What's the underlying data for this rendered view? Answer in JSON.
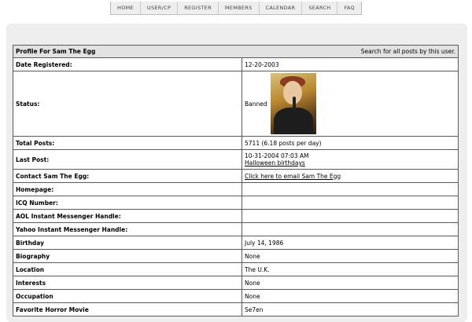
{
  "nav": [
    "HOME",
    "USER/CP",
    "REGISTER",
    "MEMBERS",
    "CALENDAR",
    "SEARCH",
    "FAQ"
  ],
  "profile": {
    "header_title": "Profile For Sam The Egg",
    "search_link": "Search for all posts by this user.",
    "date_registered_label": "Date Registered:",
    "date_registered": "12-20-2003",
    "status_label": "Status:",
    "status": "Banned",
    "total_posts_label": "Total Posts:",
    "total_posts": "5711 (6.18 posts per day)",
    "last_post_label": "Last Post:",
    "last_post_date": "10-31-2004 07:03 AM",
    "last_post_thread": "Halloween birthdays",
    "contact_label": "Contact Sam The Egg:",
    "contact_link": "Click here to email Sam The Egg",
    "homepage_label": "Homepage:",
    "homepage": "",
    "icq_label": "ICQ Number:",
    "icq": "",
    "aol_label": "AOL Instant Messenger Handle:",
    "aol": "",
    "yahoo_label": "Yahoo Instant Messenger Handle:",
    "yahoo": "",
    "birthday_label": "Birthday",
    "birthday": "July 14, 1986",
    "biography_label": "Biography",
    "biography": "None",
    "location_label": "Location",
    "location": "The U.K.",
    "interests_label": "Interests",
    "interests": "None",
    "occupation_label": "Occupation",
    "occupation": "None",
    "favorite_movie_label": "Favorite Horror Movie",
    "favorite_movie": "Se7en"
  }
}
